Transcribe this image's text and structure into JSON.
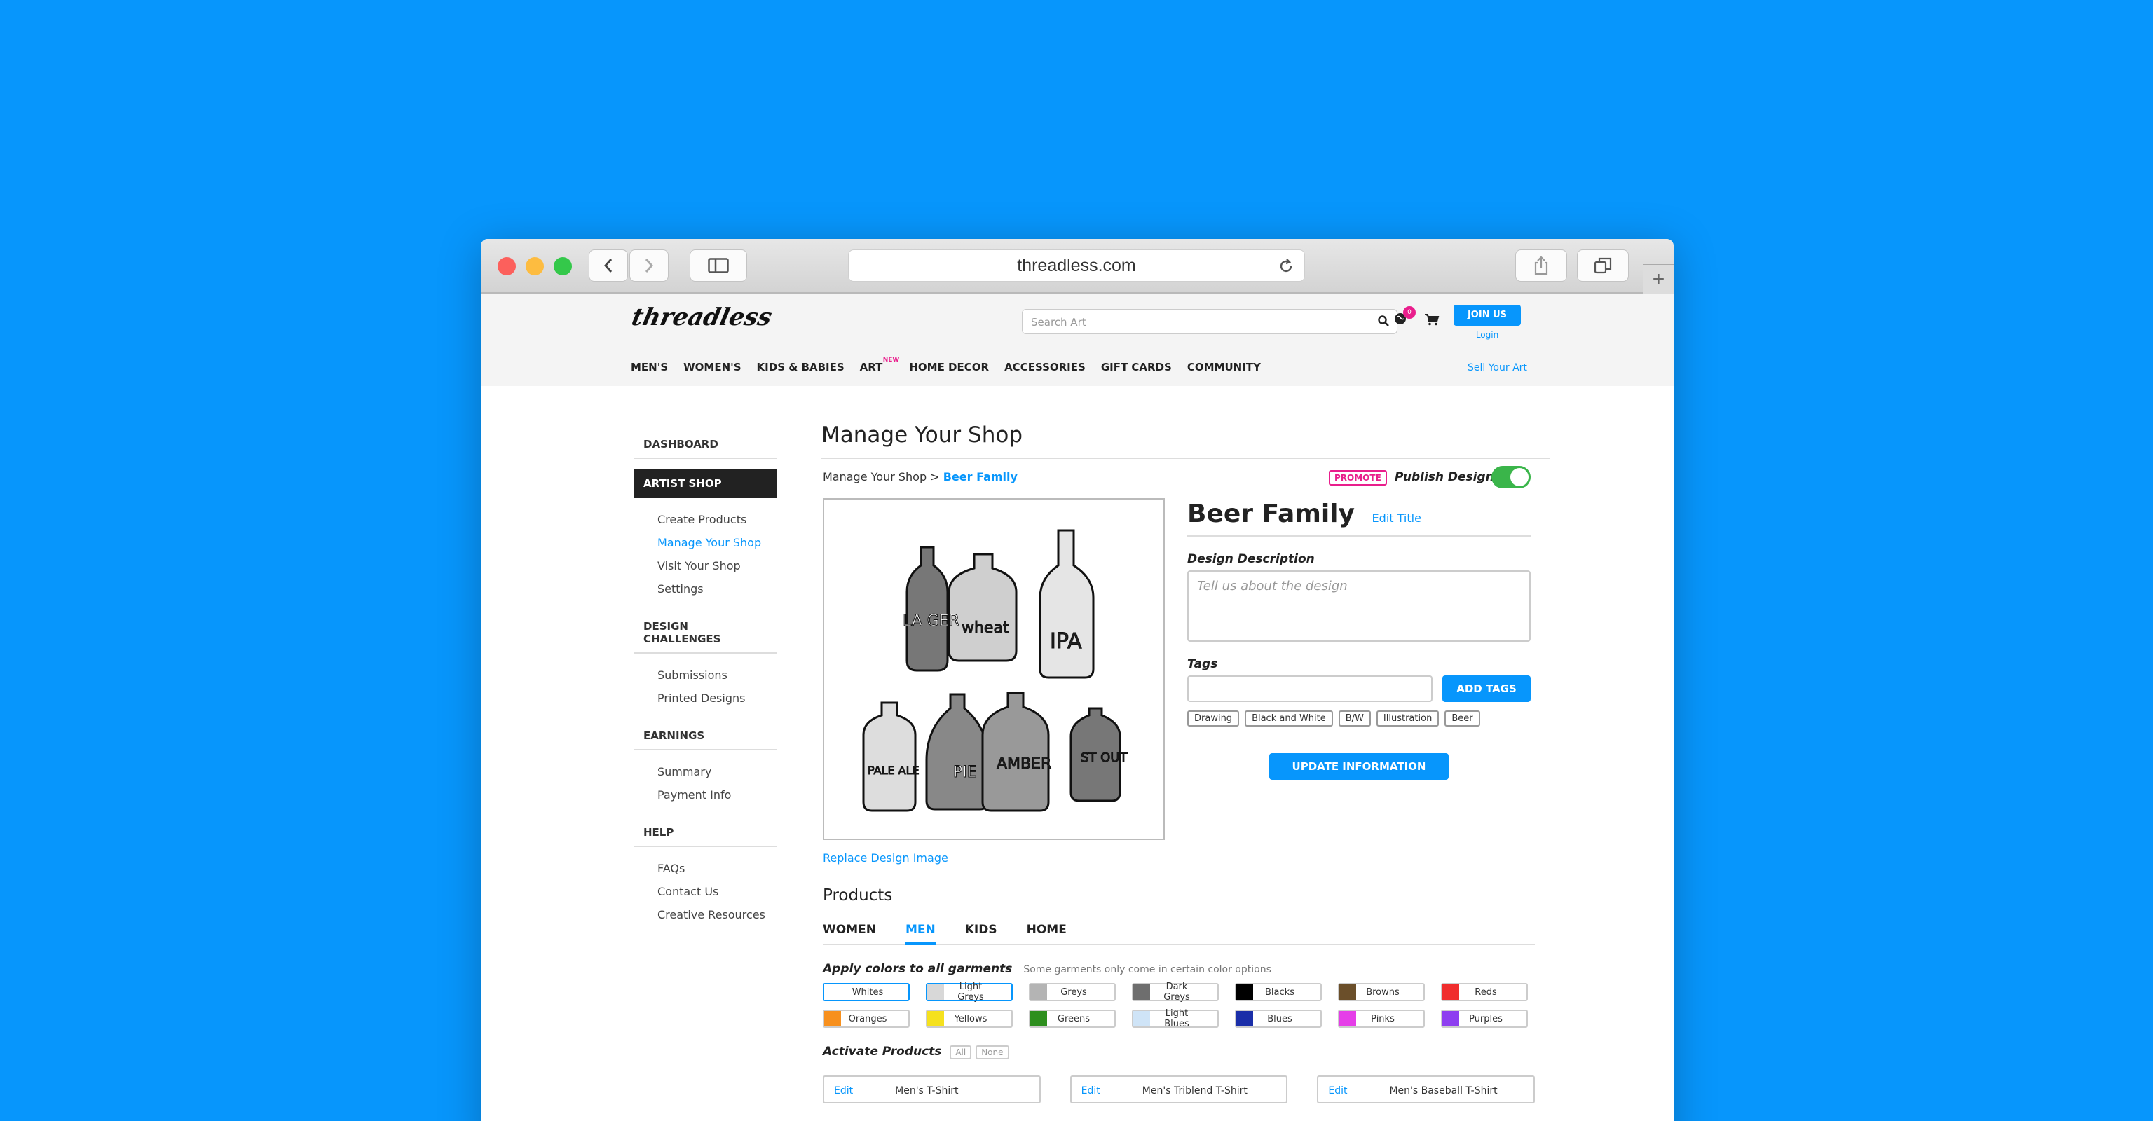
{
  "browser": {
    "url": "threadless.com"
  },
  "header": {
    "logo": "threadless",
    "search_placeholder": "Search Art",
    "badge_count": "0",
    "join_label": "JOIN US",
    "login_label": "Login",
    "nav": [
      "MEN'S",
      "WOMEN'S",
      "KIDS & BABIES",
      "ART",
      "HOME DECOR",
      "ACCESSORIES",
      "GIFT CARDS",
      "COMMUNITY"
    ],
    "nav_new_badge": "NEW",
    "sell_label": "Sell Your Art"
  },
  "sidebar": {
    "dashboard": "DASHBOARD",
    "artist_shop": "ARTIST SHOP",
    "artist_links": [
      "Create Products",
      "Manage Your Shop",
      "Visit Your Shop",
      "Settings"
    ],
    "challenges": "DESIGN CHALLENGES",
    "challenge_links": [
      "Submissions",
      "Printed Designs"
    ],
    "earnings": "EARNINGS",
    "earnings_links": [
      "Summary",
      "Payment Info"
    ],
    "help": "HELP",
    "help_links": [
      "FAQs",
      "Contact Us",
      "Creative Resources"
    ]
  },
  "main": {
    "title": "Manage Your Shop",
    "crumb_root": "Manage Your Shop",
    "crumb_sep": ">",
    "crumb_current": "Beer Family",
    "promote": "PROMOTE",
    "publish_label": "Publish Design",
    "replace_image": "Replace Design Image",
    "design_title": "Beer Family",
    "edit_title": "Edit Title",
    "desc_label": "Design Description",
    "desc_placeholder": "Tell us about the design",
    "tags_label": "Tags",
    "add_tags": "ADD TAGS",
    "tags": [
      "Drawing",
      "Black and White",
      "B/W",
      "Illustration",
      "Beer"
    ],
    "update": "UPDATE INFORMATION",
    "art_labels": [
      "LA GER",
      "wheat",
      "IPA",
      "PALE ALE",
      "PIE",
      "AMBER",
      "ST OUT"
    ]
  },
  "products": {
    "heading": "Products",
    "tabs": [
      "WOMEN",
      "MEN",
      "KIDS",
      "HOME"
    ],
    "apply_label": "Apply colors to all garments",
    "apply_note": "Some garments only come in certain color options",
    "colors": [
      {
        "name": "Whites",
        "hex": "#ffffff"
      },
      {
        "name": "Light Greys",
        "hex": "#d8d8d8"
      },
      {
        "name": "Greys",
        "hex": "#b4b4b4"
      },
      {
        "name": "Dark Greys",
        "hex": "#6e6e6e"
      },
      {
        "name": "Blacks",
        "hex": "#000000"
      },
      {
        "name": "Browns",
        "hex": "#6b4f2a"
      },
      {
        "name": "Reds",
        "hex": "#f02d2d"
      },
      {
        "name": "Oranges",
        "hex": "#f7901e"
      },
      {
        "name": "Yellows",
        "hex": "#f5e11e"
      },
      {
        "name": "Greens",
        "hex": "#2e8f1e"
      },
      {
        "name": "Light Blues",
        "hex": "#cfe4f7"
      },
      {
        "name": "Blues",
        "hex": "#1a2ea8"
      },
      {
        "name": "Pinks",
        "hex": "#e53ee8"
      },
      {
        "name": "Purples",
        "hex": "#8e3ff0"
      }
    ],
    "activate_label": "Activate Products",
    "all": "All",
    "none": "None",
    "cards": [
      {
        "edit": "Edit",
        "name": "Men's T-Shirt"
      },
      {
        "edit": "Edit",
        "name": "Men's Triblend T-Shirt"
      },
      {
        "edit": "Edit",
        "name": "Men's Baseball T-Shirt"
      }
    ]
  },
  "colors": {
    "accent": "#0796FC",
    "pink": "#e91e8c",
    "toggle": "#3ab54a"
  }
}
